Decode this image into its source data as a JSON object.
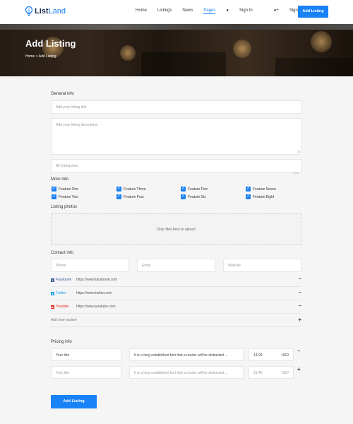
{
  "brand": {
    "name_dark": "List",
    "name_blue": "Land"
  },
  "nav": {
    "home": "Home",
    "listings": "Listings",
    "news": "News",
    "pages": "Pages",
    "sign_in": "Sign In",
    "sign_up": "Sign Up",
    "cta": "Add Listing"
  },
  "hero": {
    "title": "Add Listing",
    "breadcrumb": "Home > Add Listing"
  },
  "general": {
    "label": "General info",
    "title_placeholder": "Add your listing title",
    "description_placeholder": "Add your listing description",
    "category_placeholder": "All Categories"
  },
  "more": {
    "label": "More info",
    "features": [
      {
        "label": "Feature One",
        "checked": true
      },
      {
        "label": "Feature Three",
        "checked": true
      },
      {
        "label": "Feature Five",
        "checked": true
      },
      {
        "label": "Feature Seven",
        "checked": true
      },
      {
        "label": "Feature Two",
        "checked": true
      },
      {
        "label": "Feature Four",
        "checked": true
      },
      {
        "label": "Feature Six",
        "checked": true
      },
      {
        "label": "Feature Eight",
        "checked": true
      }
    ]
  },
  "photos": {
    "label": "Listing photos",
    "drop_text": "Drop files here to upload"
  },
  "contact": {
    "label": "Contact info",
    "phone_placeholder": "Phone",
    "email_placeholder": "Email",
    "website_placeholder": "Website",
    "socials": [
      {
        "name": "Facebook",
        "url": "https://www.facebook.com",
        "color": "#3b5998",
        "icon": "facebook-icon"
      },
      {
        "name": "Twitter",
        "url": "https://www.twitter.com",
        "color": "#1da1f2",
        "icon": "twitter-icon"
      },
      {
        "name": "Youtube",
        "url": "https://www.youtube.com",
        "color": "#e62117",
        "icon": "youtube-icon"
      }
    ],
    "add_section": "Add new section"
  },
  "pricing": {
    "label": "Pricing info",
    "rows": [
      {
        "title": "Your title",
        "desc": "It is a long established fact that a reader will be distracted ...",
        "price": "14.99",
        "currency": "USD"
      },
      {
        "title": "Your title",
        "desc": "It is a long established fact that a reader will be distracted ...",
        "price": "23.49",
        "currency": "USD"
      }
    ]
  },
  "submit": "Add Listing",
  "colors": {
    "accent": "#1a82f7"
  }
}
